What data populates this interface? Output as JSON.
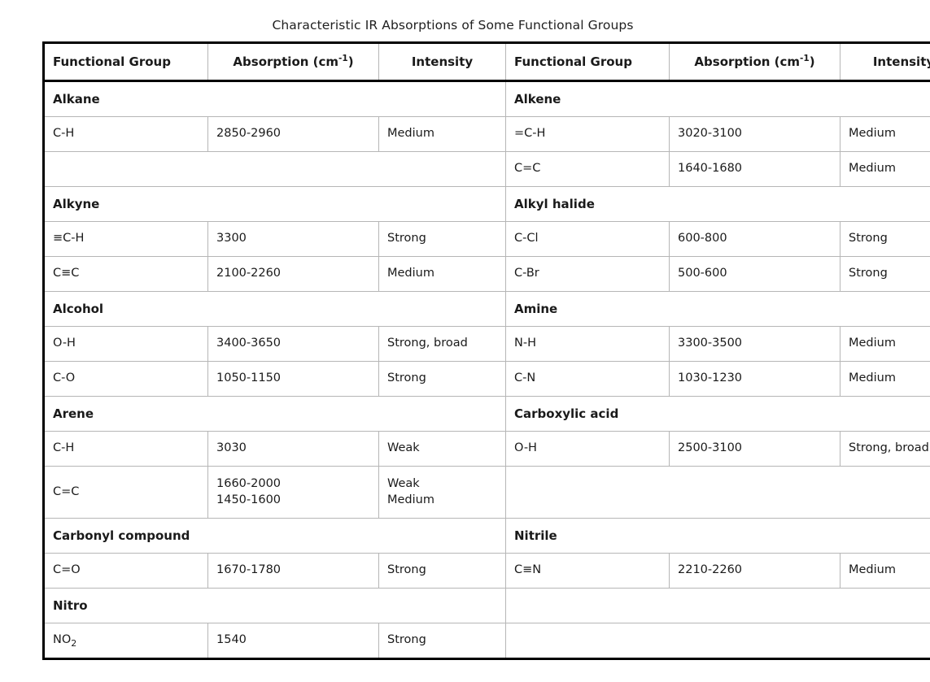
{
  "title": "Characteristic IR Absorptions of Some Functional Groups",
  "headers": {
    "functional_group": "Functional Group",
    "absorption_prefix": "Absorption (cm",
    "absorption_exponent": "-1",
    "absorption_suffix": ")",
    "intensity": "Intensity"
  },
  "groups": {
    "alkane": "Alkane",
    "alkene": "Alkene",
    "alkyne": "Alkyne",
    "alkyl_halide": "Alkyl halide",
    "alcohol": "Alcohol",
    "amine": "Amine",
    "arene": "Arene",
    "carboxylic_acid": "Carboxylic acid",
    "carbonyl_compound": "Carbonyl compound",
    "nitrile": "Nitrile",
    "nitro": "Nitro"
  },
  "rows": {
    "alkane_ch": {
      "bond": "C-H",
      "absorption": "2850-2960",
      "intensity": "Medium"
    },
    "alkene_ech": {
      "bond": "=C-H",
      "absorption": "3020-3100",
      "intensity": "Medium"
    },
    "alkene_cc": {
      "bond": "C=C",
      "absorption": "1640-1680",
      "intensity": "Medium"
    },
    "alkyne_ch": {
      "bond": "≡C-H",
      "absorption": "3300",
      "intensity": "Strong"
    },
    "alkyne_cc": {
      "bond": "C≡C",
      "absorption": "2100-2260",
      "intensity": "Medium"
    },
    "alkyl_halide_ccl": {
      "bond": "C-Cl",
      "absorption": "600-800",
      "intensity": "Strong"
    },
    "alkyl_halide_cbr": {
      "bond": "C-Br",
      "absorption": "500-600",
      "intensity": "Strong"
    },
    "alcohol_oh": {
      "bond": "O-H",
      "absorption": "3400-3650",
      "intensity": "Strong, broad"
    },
    "alcohol_co": {
      "bond": "C-O",
      "absorption": "1050-1150",
      "intensity": "Strong"
    },
    "amine_nh": {
      "bond": "N-H",
      "absorption": "3300-3500",
      "intensity": "Medium"
    },
    "amine_cn": {
      "bond": "C-N",
      "absorption": "1030-1230",
      "intensity": "Medium"
    },
    "arene_ch": {
      "bond": "C-H",
      "absorption": "3030",
      "intensity": "Weak"
    },
    "arene_cc": {
      "bond": "C=C",
      "absorption": "1660-2000\n1450-1600",
      "intensity": "Weak\nMedium"
    },
    "carboxylic_acid_oh": {
      "bond": "O-H",
      "absorption": "2500-3100",
      "intensity": "Strong, broad"
    },
    "carbonyl_co": {
      "bond": "C=O",
      "absorption": "1670-1780",
      "intensity": "Strong"
    },
    "nitrile_cn": {
      "bond": "C≡N",
      "absorption": "2210-2260",
      "intensity": "Medium"
    },
    "nitro_no2": {
      "bond_prefix": "NO",
      "bond_subscript": "2",
      "absorption": "1540",
      "intensity": "Strong"
    }
  },
  "colors": {
    "outer_border": "#000000",
    "inner_border": "#b6b6b6",
    "text": "#1a1a1a",
    "background": "#ffffff"
  }
}
